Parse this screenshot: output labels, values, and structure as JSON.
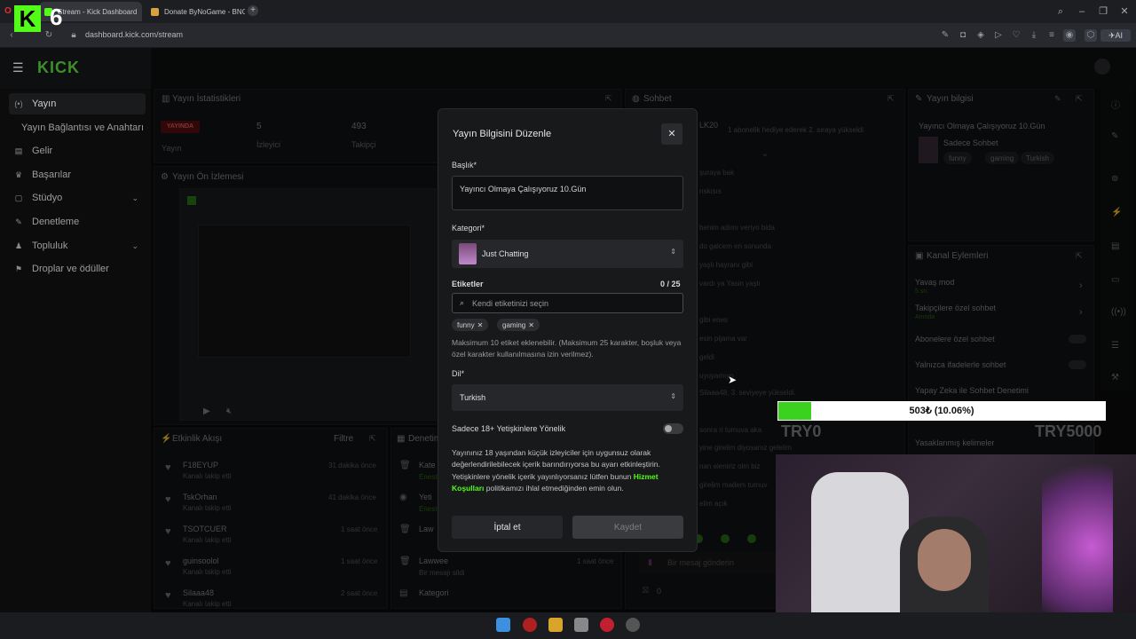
{
  "browser": {
    "tabs": [
      {
        "label": "Stream - Kick Dashboard",
        "favicon_color": "#53fc18"
      },
      {
        "label": "Donate ByNoGame - BNG",
        "favicon_color": "#d8a33a"
      }
    ],
    "url": "dashboard.kick.com/stream",
    "overlay_k": "K",
    "overlay_number": "6",
    "new_tab": "+",
    "ai_button": "AI"
  },
  "app": {
    "logo": "KICK",
    "sidebar": [
      {
        "label": "Yayın",
        "icon": "broadcast-icon",
        "active": true
      },
      {
        "label": "Yayın Bağlantısı ve Anahtarı",
        "icon": "",
        "active": false
      },
      {
        "label": "Gelir",
        "icon": "revenue-icon",
        "active": false
      },
      {
        "label": "Başarılar",
        "icon": "trophy-icon",
        "active": false
      },
      {
        "label": "Stüdyo",
        "icon": "studio-icon",
        "active": false,
        "expandable": true
      },
      {
        "label": "Denetleme",
        "icon": "wrench-icon",
        "active": false
      },
      {
        "label": "Topluluk",
        "icon": "community-icon",
        "active": false,
        "expandable": true
      },
      {
        "label": "Droplar ve ödüller",
        "icon": "gift-icon",
        "active": false
      }
    ]
  },
  "stats": {
    "title": "Yayın İstatistikleri",
    "status_badge": "YAYINDA",
    "status_label": "Yayın",
    "viewers_value": "5",
    "viewers_label": "İzleyici",
    "followers_value": "493",
    "followers_label": "Takipçi"
  },
  "preview": {
    "title": "Yayın Ön İzlemesi"
  },
  "activity": {
    "title": "Etkinlik Akışı",
    "filter": "Filtre",
    "items": [
      {
        "name": "F18EYUP",
        "sub": "Kanalı takip etti",
        "time": "31 dakika önce"
      },
      {
        "name": "TskOrhan",
        "sub": "Kanalı takip etti",
        "time": "41 dakika önce"
      },
      {
        "name": "TSOTCUER",
        "sub": "Kanalı takip etti",
        "time": "1 saat önce"
      },
      {
        "name": "guinsoolol",
        "sub": "Kanalı takip etti",
        "time": "1 saat önce"
      },
      {
        "name": "Silaaa48",
        "sub": "Kanalı takip etti",
        "time": "2 saat önce"
      }
    ]
  },
  "moderation": {
    "title": "Denetim",
    "items": [
      {
        "name": "Kate",
        "sub": "Eneste",
        "time": ""
      },
      {
        "name": "Yeti",
        "sub": "Eneste",
        "time": ""
      },
      {
        "name": "Law",
        "sub": "",
        "time": ""
      },
      {
        "name": "Lawwee",
        "sub": "Bir mesajı sildi",
        "time": "1 saat önce"
      },
      {
        "name": "Kategori",
        "sub": "",
        "time": ""
      }
    ]
  },
  "chat": {
    "title": "Sohbet",
    "header_user": "LK20",
    "header_note": "1 abonelik hediye ederek 2. sıraya yükseldi",
    "lines": [
      "şuraya bak",
      "nskısıs",
      "benim adımı veriyo bida",
      "do galcem en sonunda",
      "yaşlı hayranı gibi",
      "vardı ya Yasin yaşlı",
      "gibi enes",
      "esin pijama var",
      "geldi",
      "uyuyamıyo",
      "Silaaa48, 3. seviyeye yükseldi.",
      "sonra ri tumuva aka",
      "yine girelim diyosanız gelelim",
      "nan eleniriz olm biz",
      "girelim madem tumuv",
      "elim açık"
    ],
    "placeholder": "Bir mesaj gönderin",
    "count": "0"
  },
  "stream_info": {
    "title": "Yayın bilgisi",
    "stream_title": "Yayıncı Olmaya Çalışıyoruz 10.Gün",
    "category": "Sadece Sohbet",
    "language": "Turkish",
    "tags": [
      "funny",
      "gaming"
    ]
  },
  "channel_actions": {
    "title": "Kanal Eylemleri",
    "items": [
      {
        "label": "Yavaş mod",
        "sub": "5 sn.",
        "control": "chevron"
      },
      {
        "label": "Takipçilere özel sohbet",
        "sub": "Anında",
        "control": "chevron"
      },
      {
        "label": "Abonelere özel sohbet",
        "sub": "",
        "control": "toggle"
      },
      {
        "label": "Yalnızca ifadelerle sohbet",
        "sub": "",
        "control": "toggle"
      },
      {
        "label": "Yapay Zeka ile Sohbet Denetimi",
        "sub": "",
        "control": "link"
      },
      {
        "label": "Yasaklanmış kelimeler",
        "sub": "",
        "control": "chevron"
      }
    ]
  },
  "modal": {
    "title": "Yayın Bilgisini Düzenle",
    "title_label": "Başlık*",
    "title_value": "Yayıncı Olmaya Çalışıyoruz 10.Gün",
    "category_label": "Kategori*",
    "category_value": "Just Chatting",
    "tags_label": "Etiketler",
    "tags_count": "0 / 25",
    "tags_placeholder": "Kendi etiketinizi seçin",
    "tags": [
      "funny",
      "gaming"
    ],
    "tags_help": "Maksimum 10 etiket eklenebilir. (Maksimum 25 karakter, boşluk veya özel karakter kullanılmasına izin verilmez).",
    "language_label": "Dil*",
    "language_value": "Turkish",
    "adult_label": "Sadece 18+ Yetişkinlere Yönelik",
    "adult_on": false,
    "disclaimer_before": "Yayınınız 18 yaşından küçük izleyiciler için uygunsuz olarak değerlendirilebilecek içerik barındırıyorsa bu ayarı etkinleştirin. Yetişkinlere yönelik içerik yayınlıyorsanız lütfen bunun ",
    "disclaimer_link": "Hizmet Koşulları",
    "disclaimer_after": " politikamızı ihlal etmediğinden emin olun.",
    "cancel": "İptal et",
    "save": "Kaydet"
  },
  "donation": {
    "progress_text": "503₺ (10.06%)",
    "progress": 0.1006,
    "left_label": "TRY0",
    "right_label": "TRY5000"
  },
  "colors": {
    "accent": "#53fc18",
    "live": "#e91916",
    "bar": "#3ad21f"
  }
}
